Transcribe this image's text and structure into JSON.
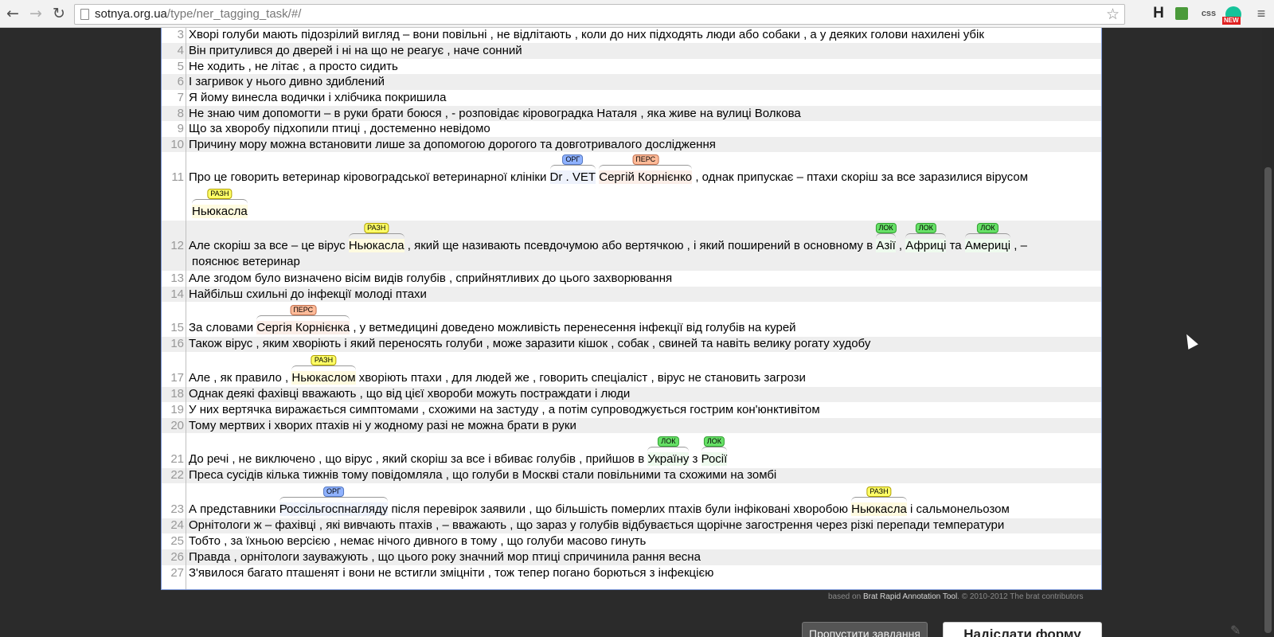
{
  "browser": {
    "url_domain": "sotnya.org.ua",
    "url_path": "/type/ner_tagging_task/#/",
    "back_icon": "back-arrow-icon",
    "forward_icon": "forward-arrow-icon",
    "reload_icon": "reload-icon",
    "star_icon": "bookmark-star-icon",
    "extensions": {
      "h_label": "H",
      "css_label": "css",
      "new_badge": "NEW"
    }
  },
  "entity_types": {
    "org": "ОРГ",
    "pers": "ПЕРС",
    "misc": "РАЗН",
    "loc": "ЛОК"
  },
  "lines": {
    "l3": {
      "num": "3",
      "text": "Хворі голуби мають підозрілий вигляд – вони повільні , не відлітають , коли до них підходять люди або собаки , а у деяких голови нахилені убік"
    },
    "l4": {
      "num": "4",
      "text": "Він притулився до дверей і ні на що не реагує , наче сонний"
    },
    "l5": {
      "num": "5",
      "text": "Не ходить , не літає , а просто сидить"
    },
    "l6": {
      "num": "6",
      "text": "І загривок у нього дивно здиблений"
    },
    "l7": {
      "num": "7",
      "text": "Я йому винесла водички і хлібчика покришила"
    },
    "l8": {
      "num": "8",
      "text": "Не знаю чим допомогти – в руки брати боюся , - розповідає кіровоградка Наталя , яка живе на вулиці Волкова"
    },
    "l9": {
      "num": "9",
      "text": "Що за хворобу підхопили птиці , достеменно невідомо"
    },
    "l10": {
      "num": "10",
      "text": "Причину мору можна встановити лише за допомогою дорогого та довготривалого дослідження"
    },
    "l11": {
      "num": "11",
      "a": "Про це говорить ветеринар кіровоградської ветеринарної клініки ",
      "e1": "Dr . VET",
      "b": " ",
      "e2": "Сергій Корнієнко",
      "c": " , однак припускає – птахи скоріш за все заразилися вірусом",
      "e3": "Ньюкасла"
    },
    "l12": {
      "num": "12",
      "a": "Але скоріш за все – це вірус ",
      "e1": "Ньюкасла",
      "b": " , який ще називають псевдочумою або вертячкою , і який поширений в основному в ",
      "e2": "Азії",
      "c": " , ",
      "e3": "Африці",
      "d": " та ",
      "e4": "Америці",
      "f": " , –",
      "cont": "пояснює ветеринар"
    },
    "l13": {
      "num": "13",
      "text": "Але згодом було визначено вісім видів голубів , сприйнятливих до цього захворювання"
    },
    "l14": {
      "num": "14",
      "text": "Найбільш схильні до інфекції молоді птахи"
    },
    "l15": {
      "num": "15",
      "a": "За словами ",
      "e1": "Сергія Корнієнка",
      "b": " , у ветмедицині доведено можливість перенесення інфекції від голубів на курей"
    },
    "l16": {
      "num": "16",
      "text": "Також вірус , яким хворіють і який переносять голуби , може заразити кішок , собак , свиней та навіть велику рогату худобу"
    },
    "l17": {
      "num": "17",
      "a": "Але , як правило , ",
      "e1": "Ньюкаслом",
      "b": " хворіють птахи , для людей же , говорить спеціаліст , вірус не становить загрози"
    },
    "l18": {
      "num": "18",
      "text": "Однак деякі фахівці вважають , що від цієї хвороби можуть постраждати і люди"
    },
    "l19": {
      "num": "19",
      "text": "У них вертячка виражається симптомами , схожими на застуду , а потім супроводжується гострим кон'юнктивітом"
    },
    "l20": {
      "num": "20",
      "text": "Тому мертвих і хворих птахів ні у жодному разі не можна брати в руки"
    },
    "l21": {
      "num": "21",
      "a": "До речі , не виключено , що вірус , який скоріш за все і вбиває голубів , прийшов в ",
      "e1": "Україну",
      "b": " з ",
      "e2": "Росії"
    },
    "l22": {
      "num": "22",
      "text": "Преса сусідів кілька тижнів тому повідомляла , що голуби в Москві стали повільними та схожими на зомбі"
    },
    "l23": {
      "num": "23",
      "a": "А представники ",
      "e1": "Россільгоспнагляду",
      "b": " після перевірок заявили , що більшість померлих птахів були інфіковані хворобою ",
      "e2": "Ньюкасла",
      "c": " і сальмонельозом"
    },
    "l24": {
      "num": "24",
      "text": "Орнітологи ж – фахівці , які вивчають птахів , – вважають , що зараз у голубів відбувається щорічне загострення через різкі перепади температури"
    },
    "l25": {
      "num": "25",
      "text": "Тобто , за їхньою версією , немає нічого дивного в тому , що голуби масово гинуть"
    },
    "l26": {
      "num": "26",
      "text": "Правда , орнітологи зауважують , що цього року значний мор птиці спричинила рання весна"
    },
    "l27": {
      "num": "27",
      "text": "З'явилося багато пташенят і вони не встигли зміцніти , тож тепер погано борються з інфекцією"
    }
  },
  "footer": {
    "based_on": "based on ",
    "tool_name": "Brat Rapid Annotation Tool",
    "copyright": ". © 2010-2012 The brat contributors"
  },
  "buttons": {
    "skip": "Пропустити завдання",
    "submit": "Надіслати форму"
  }
}
